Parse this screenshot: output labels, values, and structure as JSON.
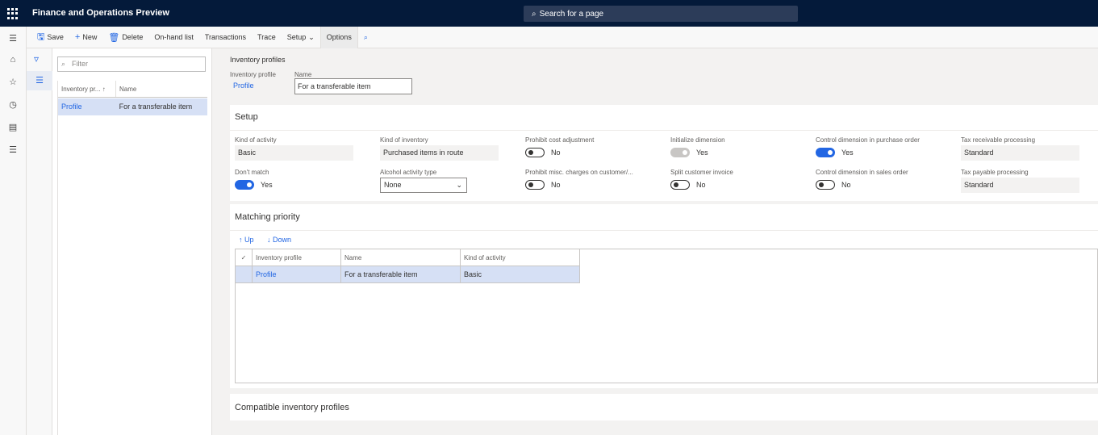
{
  "app": {
    "title": "Finance and Operations Preview",
    "search_placeholder": "Search for a page"
  },
  "actions": {
    "save": "Save",
    "new": "New",
    "delete": "Delete",
    "onhand": "On-hand list",
    "transactions": "Transactions",
    "trace": "Trace",
    "setup": "Setup",
    "options": "Options"
  },
  "list": {
    "filter_placeholder": "Filter",
    "col_profile": "Inventory pr...",
    "col_name": "Name",
    "rows": [
      {
        "profile": "Profile",
        "name": "For a transferable item"
      }
    ]
  },
  "header": {
    "breadcrumb": "Inventory profiles",
    "profile_label": "Inventory profile",
    "profile_value": "Profile",
    "name_label": "Name",
    "name_value": "For a transferable item"
  },
  "setup": {
    "title": "Setup",
    "kind_activity_label": "Kind of activity",
    "kind_activity_value": "Basic",
    "kind_inventory_label": "Kind of inventory",
    "kind_inventory_value": "Purchased items in route",
    "prohibit_cost_label": "Prohibit cost adjustment",
    "prohibit_cost_value": "No",
    "init_dim_label": "Initialize dimension",
    "init_dim_value": "Yes",
    "ctrl_dim_po_label": "Control dimension in purchase order",
    "ctrl_dim_po_value": "Yes",
    "tax_recv_label": "Tax receivable processing",
    "tax_recv_value": "Standard",
    "dont_match_label": "Don't match",
    "dont_match_value": "Yes",
    "alcohol_label": "Alcohol activity type",
    "alcohol_value": "None",
    "prohibit_misc_label": "Prohibit misc. charges on customer/...",
    "prohibit_misc_value": "No",
    "split_inv_label": "Split customer invoice",
    "split_inv_value": "No",
    "ctrl_dim_so_label": "Control dimension in sales order",
    "ctrl_dim_so_value": "No",
    "tax_pay_label": "Tax payable processing",
    "tax_pay_value": "Standard"
  },
  "matching": {
    "title": "Matching priority",
    "up": "Up",
    "down": "Down",
    "col_profile": "Inventory profile",
    "col_name": "Name",
    "col_kind": "Kind of activity",
    "rows": [
      {
        "profile": "Profile",
        "name": "For a transferable item",
        "kind": "Basic"
      }
    ]
  },
  "compatible": {
    "title": "Compatible inventory profiles"
  }
}
